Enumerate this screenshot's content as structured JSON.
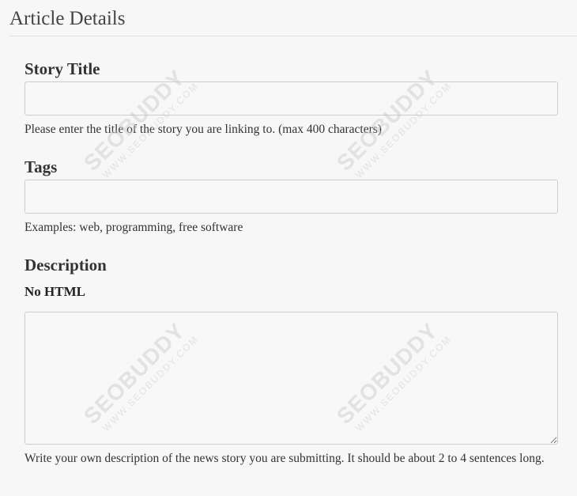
{
  "page": {
    "title": "Article Details"
  },
  "story_title": {
    "label": "Story Title",
    "value": "",
    "help": "Please enter the title of the story you are linking to. (max 400 characters)"
  },
  "tags": {
    "label": "Tags",
    "value": "",
    "help": "Examples: web, programming, free software"
  },
  "description": {
    "label": "Description",
    "sublabel": "No HTML",
    "value": "",
    "help": "Write your own description of the news story you are submitting. It should be about 2 to 4 sentences long."
  },
  "watermark": {
    "brand": "SEOBUDDY",
    "url": "WWW.SEOBUDDY.COM"
  }
}
